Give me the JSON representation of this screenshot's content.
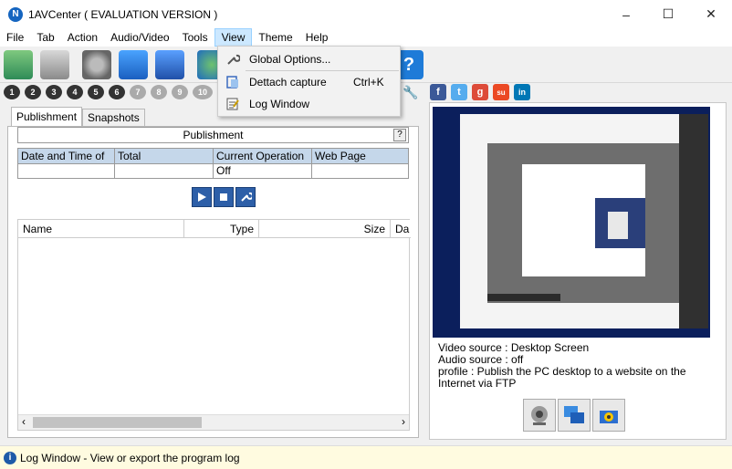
{
  "window": {
    "title": "1AVCenter ( EVALUATION VERSION )",
    "app_icon": "N"
  },
  "controls": {
    "minimize": "–",
    "maximize": "☐",
    "close": "✕"
  },
  "menu": {
    "items": [
      "File",
      "Tab",
      "Action",
      "Audio/Video",
      "Tools",
      "View",
      "Theme",
      "Help"
    ],
    "active": "View"
  },
  "view_menu": {
    "global_options": "Global Options...",
    "dettach_capture": "Dettach capture",
    "dettach_shortcut": "Ctrl+K",
    "log_window": "Log Window"
  },
  "numbers": [
    "1",
    "2",
    "3",
    "4",
    "5",
    "6",
    "7",
    "8",
    "9",
    "10"
  ],
  "social": {
    "facebook": "f",
    "twitter": "t",
    "google": "g",
    "stumbleupon": "su",
    "linkedin": "in"
  },
  "toolbar": {
    "help_label": "?"
  },
  "tabs": {
    "publishment": "Publishment",
    "snapshots": "Snapshots"
  },
  "publishment": {
    "header": "Publishment",
    "help": "?",
    "columns": [
      "Date and Time of",
      "Total",
      "Current Operation",
      "Web Page"
    ],
    "row": [
      "",
      "",
      "Off",
      ""
    ]
  },
  "file_list": {
    "columns": {
      "name": "Name",
      "type": "Type",
      "size": "Size",
      "date": "Da"
    }
  },
  "scroll": {
    "left": "‹",
    "right": "›"
  },
  "source_info": {
    "video": "Video source : Desktop Screen",
    "audio": "Audio source : off",
    "profile": "profile : Publish the PC desktop to a website on the Internet via FTP"
  },
  "status": {
    "text": "Log Window - View or export the program log",
    "icon": "i"
  },
  "colors": {
    "accent": "#2d5fa8",
    "status_bg": "#fffbe0",
    "menu_highlight": "#cce8ff"
  }
}
